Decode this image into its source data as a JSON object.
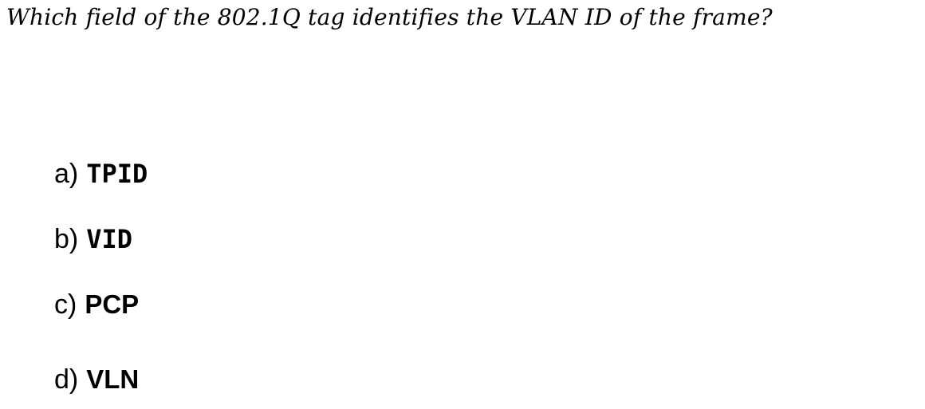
{
  "question": "Which field of the 802.1Q tag identifies the VLAN ID of the frame?",
  "options": [
    {
      "letter": "a)",
      "text": "TPID"
    },
    {
      "letter": "b)",
      "text": "VID"
    },
    {
      "letter": "c)",
      "text": "PCP"
    },
    {
      "letter": "d)",
      "text": "VLN"
    }
  ]
}
